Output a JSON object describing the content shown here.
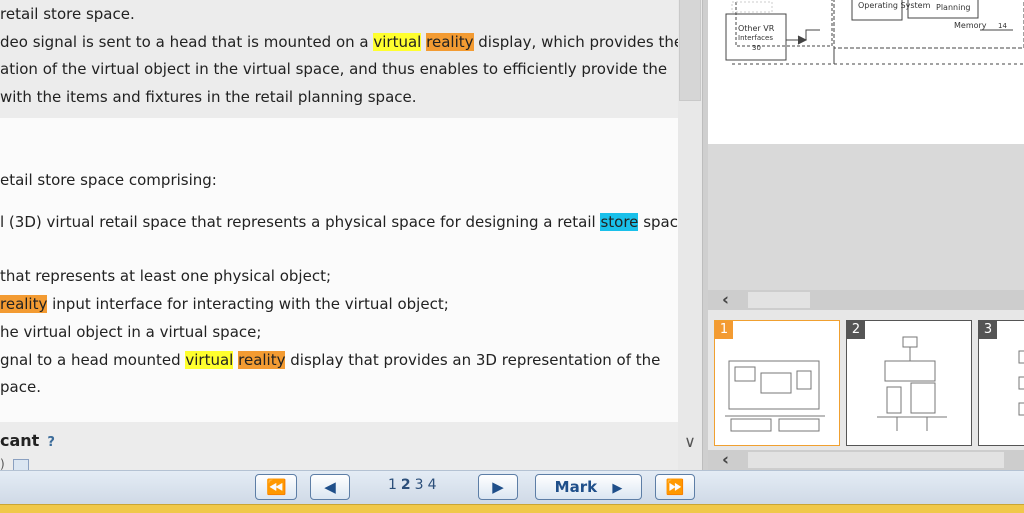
{
  "text": {
    "block1": [
      {
        "parts": [
          {
            "t": "retail store space."
          }
        ]
      },
      {
        "parts": [
          {
            "t": "deo signal is sent to a head that is mounted on a "
          },
          {
            "t": "virtual",
            "h": "y"
          },
          {
            "t": " "
          },
          {
            "t": "reality",
            "h": "o"
          },
          {
            "t": " display, which provides the"
          }
        ]
      },
      {
        "parts": [
          {
            "t": "ation of the virtual object in the virtual space, and thus enables to efficiently provide the"
          }
        ]
      },
      {
        "parts": [
          {
            "t": "with the items and fixtures in the retail planning space."
          }
        ]
      }
    ],
    "claim_intro": "etail store space comprising:",
    "claim_line1": [
      {
        "t": "l (3D) virtual retail space that represents a physical space for designing a retail "
      },
      {
        "t": "store",
        "h": "c"
      },
      {
        "t": " space"
      }
    ],
    "claim_lines": [
      {
        "parts": [
          {
            "t": " that represents at least one physical object;"
          }
        ]
      },
      {
        "parts": [
          {
            "t": "reality",
            "h": "o"
          },
          {
            "t": " input interface for interacting with the virtual object;"
          }
        ]
      },
      {
        "parts": [
          {
            "t": "he virtual object in a virtual space;"
          }
        ]
      },
      {
        "parts": [
          {
            "t": "gnal to a head mounted "
          },
          {
            "t": "virtual",
            "h": "y"
          },
          {
            "t": " "
          },
          {
            "t": "reality",
            "h": "o"
          },
          {
            "t": " display that provides an 3D representation of the"
          }
        ]
      },
      {
        "parts": [
          {
            "t": "pace."
          }
        ]
      }
    ],
    "section_title": "cant",
    "help_mark": "?",
    "trailing_text": ")"
  },
  "drawing": {
    "labels": {
      "box_a": "Operating System",
      "box_b": "Planning",
      "memory": "Memory",
      "memory_ref": "14",
      "vr": "Other VR",
      "vr2": "Interfaces",
      "vr_ref": "30"
    }
  },
  "thumbnails": [
    {
      "num": "1",
      "selected": true
    },
    {
      "num": "2",
      "selected": false
    },
    {
      "num": "3",
      "selected": false
    }
  ],
  "nav": {
    "first_icon": "⏪",
    "prev_icon": "◀",
    "pages": [
      "1",
      "2",
      "3",
      "4"
    ],
    "current_page": "2",
    "next_icon": "▶",
    "mark_label": "Mark",
    "mark_icon": "▶",
    "last_icon": "⏩"
  },
  "colors": {
    "highlight_virtual": "#ffff2e",
    "highlight_reality": "#f39b32",
    "highlight_store": "#19c0ea",
    "selected_thumb": "#f39b32"
  }
}
